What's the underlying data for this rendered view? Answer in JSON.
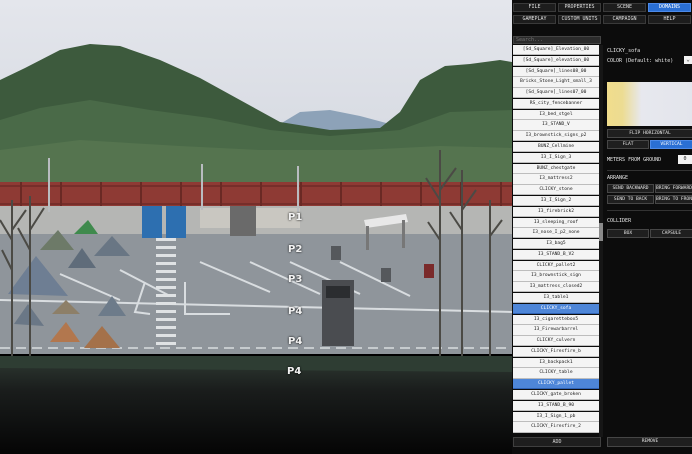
{
  "menu": {
    "row1": [
      {
        "label": "FILE",
        "active": false
      },
      {
        "label": "PROPERTIES",
        "active": false
      },
      {
        "label": "SCENE",
        "active": false
      },
      {
        "label": "DOMAINS",
        "active": true
      }
    ],
    "row2": [
      {
        "label": "GAMEPLAY",
        "active": false
      },
      {
        "label": "CUSTOM UNITS",
        "active": false
      },
      {
        "label": "CAMPAIGN",
        "active": false
      },
      {
        "label": "HELP",
        "active": false
      }
    ]
  },
  "search": {
    "placeholder": "Search..."
  },
  "list": {
    "items": [
      "[Sd_Square]_Elevation_00",
      "[Sd_Square]_elevation_00",
      "[Sd_Square]_lines08_00",
      "Bricks_Stone_Light_small_3",
      "[Sd_Square]_lines07_00",
      "RS_city_fencebanner",
      "I3_bed_stgel",
      "I3_STAND_V",
      "I3_brownstick_signs_p2",
      "BUNZ_Cellmine",
      "I3_I_Sign_3",
      "BUNZ_chestgate",
      "I3_mattress2",
      "CLICKY_stone",
      "I3_I_Sign_2",
      "I3_firebrick2",
      "I3_sleeping_roof",
      "I3_nose_I_p2_none",
      "I3_bag5",
      "I3_STAND_B_V2",
      "CLICKY_pallet2",
      "I3_brownstick_sign",
      "I3_mattress_closed2",
      "I3_table1",
      "CLICKY_sofa",
      "I3_cigarettebox5",
      "I3_Firewarbarrel",
      "CLICKY_culvern",
      "CLICKY_Firesfire_b",
      "I3_backpack1",
      "CLICKY_table",
      "CLICKY_pallet",
      "CLICKY_gate_broken",
      "I3_STAND_B_90",
      "I3_I_Sign_1_pb",
      "CLICKY_Firesfire_2"
    ],
    "selected": [
      "CLICKY_sofa",
      "CLICKY_pallet"
    ],
    "add_label": "ADD"
  },
  "properties": {
    "object_name": "CLICKY_sofa",
    "color_label": "COLOR (Default: white)",
    "color_swatches": [
      "#f1dd8c",
      "#e5e7ee"
    ],
    "flip_horizontal": "FLIP HORIZONTAL",
    "orientation": {
      "flat": "FLAT",
      "vertical": "VERTICAL",
      "active": "VERTICAL"
    },
    "meters_label": "METERS FROM GROUND",
    "meters_value": "0",
    "arrange_label": "ARRANGE",
    "arrange_buttons": [
      "SEND BACKWARD",
      "BRING FORWARD",
      "SEND TO BACK",
      "BRING TO FRONT"
    ],
    "collider_label": "COLLIDER",
    "collider_buttons": [
      "BOX",
      "CAPSULE"
    ],
    "remove_label": "REMOVE"
  },
  "scene": {
    "parking_labels": [
      "P1",
      "P2",
      "P3",
      "P4",
      "P4",
      "P4"
    ],
    "sky_color": "#dcdfe6",
    "ground_color": "#8e9398"
  }
}
